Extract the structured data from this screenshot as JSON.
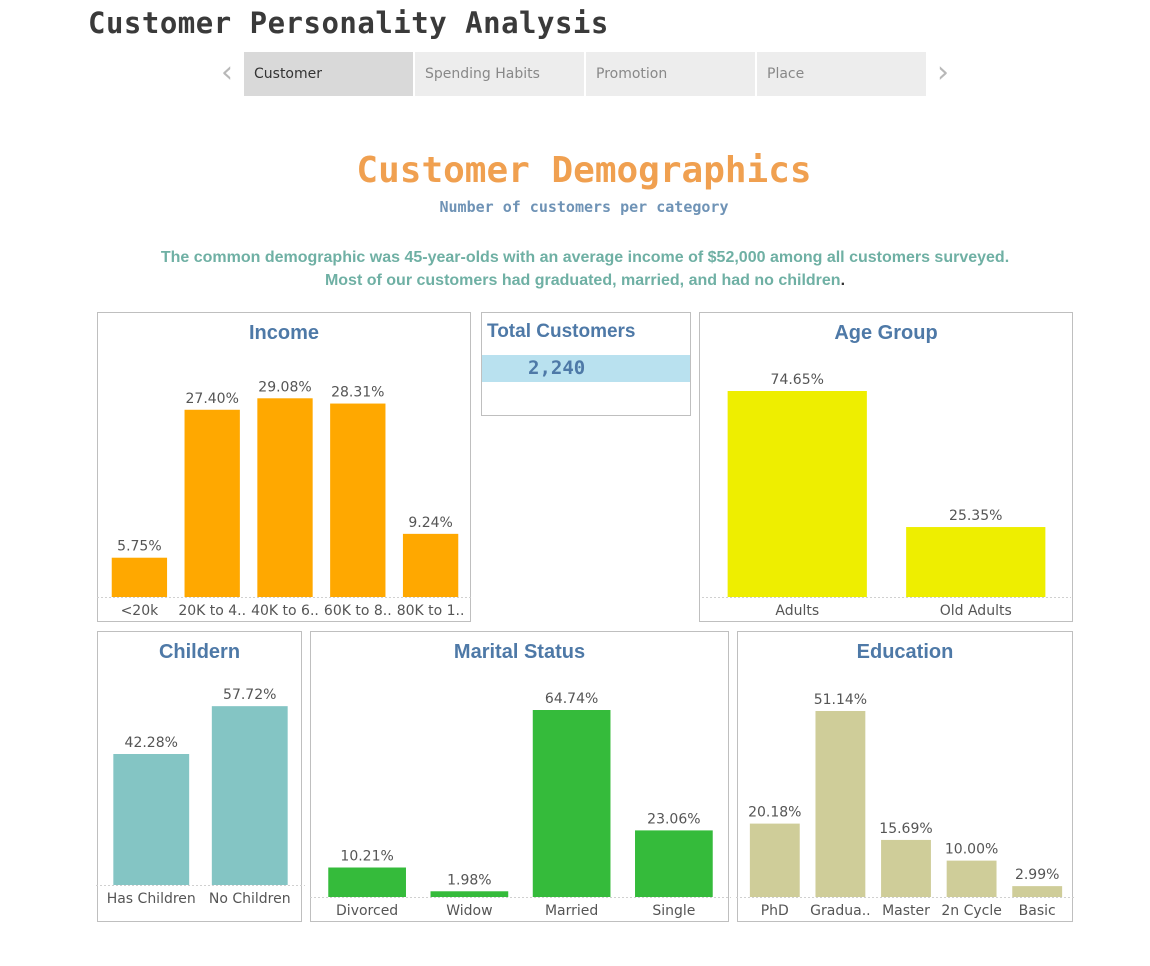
{
  "app": {
    "title": "Customer Personality Analysis"
  },
  "nav": {
    "tabs": [
      {
        "label": "Customer",
        "active": true
      },
      {
        "label": "Spending Habits",
        "active": false
      },
      {
        "label": "Promotion",
        "active": false
      },
      {
        "label": "Place",
        "active": false
      }
    ],
    "prev_icon": "chevron-left-icon",
    "next_icon": "chevron-right-icon"
  },
  "header": {
    "headline": "Customer Demographics",
    "subheadline": "Number of customers per category",
    "summary_line1": "The common demographic was 45-year-olds with an average income of $52,000 among all customers surveyed.",
    "summary_line2": "Most of our customers had graduated, married, and had no children",
    "summary_period": "."
  },
  "total_customers": {
    "title": "Total Customers",
    "value": "2,240"
  },
  "colors": {
    "income": "#ffa800",
    "age": "#eeee00",
    "children": "#84c5c4",
    "marital": "#35bb3b",
    "education": "#cfcd99",
    "title": "#4e79a7"
  },
  "chart_data": [
    {
      "id": "income",
      "type": "bar",
      "title": "Income",
      "categories": [
        "<20k",
        "20K to 4..",
        "40K to 6..",
        "60K to 8..",
        "80K to 1.."
      ],
      "values": [
        5.75,
        27.4,
        29.08,
        28.31,
        9.24
      ],
      "value_labels": [
        "5.75%",
        "27.40%",
        "29.08%",
        "28.31%",
        "9.24%"
      ]
    },
    {
      "id": "age",
      "type": "bar",
      "title": "Age Group",
      "categories": [
        "Adults",
        "Old Adults"
      ],
      "values": [
        74.65,
        25.35
      ],
      "value_labels": [
        "74.65%",
        "25.35%"
      ]
    },
    {
      "id": "children",
      "type": "bar",
      "title": "Childern",
      "categories": [
        "Has Children",
        "No Children"
      ],
      "values": [
        42.28,
        57.72
      ],
      "value_labels": [
        "42.28%",
        "57.72%"
      ]
    },
    {
      "id": "marital",
      "type": "bar",
      "title": "Marital Status",
      "categories": [
        "Divorced",
        "Widow",
        "Married",
        "Single"
      ],
      "values": [
        10.21,
        1.98,
        64.74,
        23.06
      ],
      "value_labels": [
        "10.21%",
        "1.98%",
        "64.74%",
        "23.06%"
      ]
    },
    {
      "id": "education",
      "type": "bar",
      "title": "Education",
      "categories": [
        "PhD",
        "Gradua..",
        "Master",
        "2n Cycle",
        "Basic"
      ],
      "values": [
        20.18,
        51.14,
        15.69,
        10.0,
        2.99
      ],
      "value_labels": [
        "20.18%",
        "51.14%",
        "15.69%",
        "10.00%",
        "2.99%"
      ]
    }
  ]
}
